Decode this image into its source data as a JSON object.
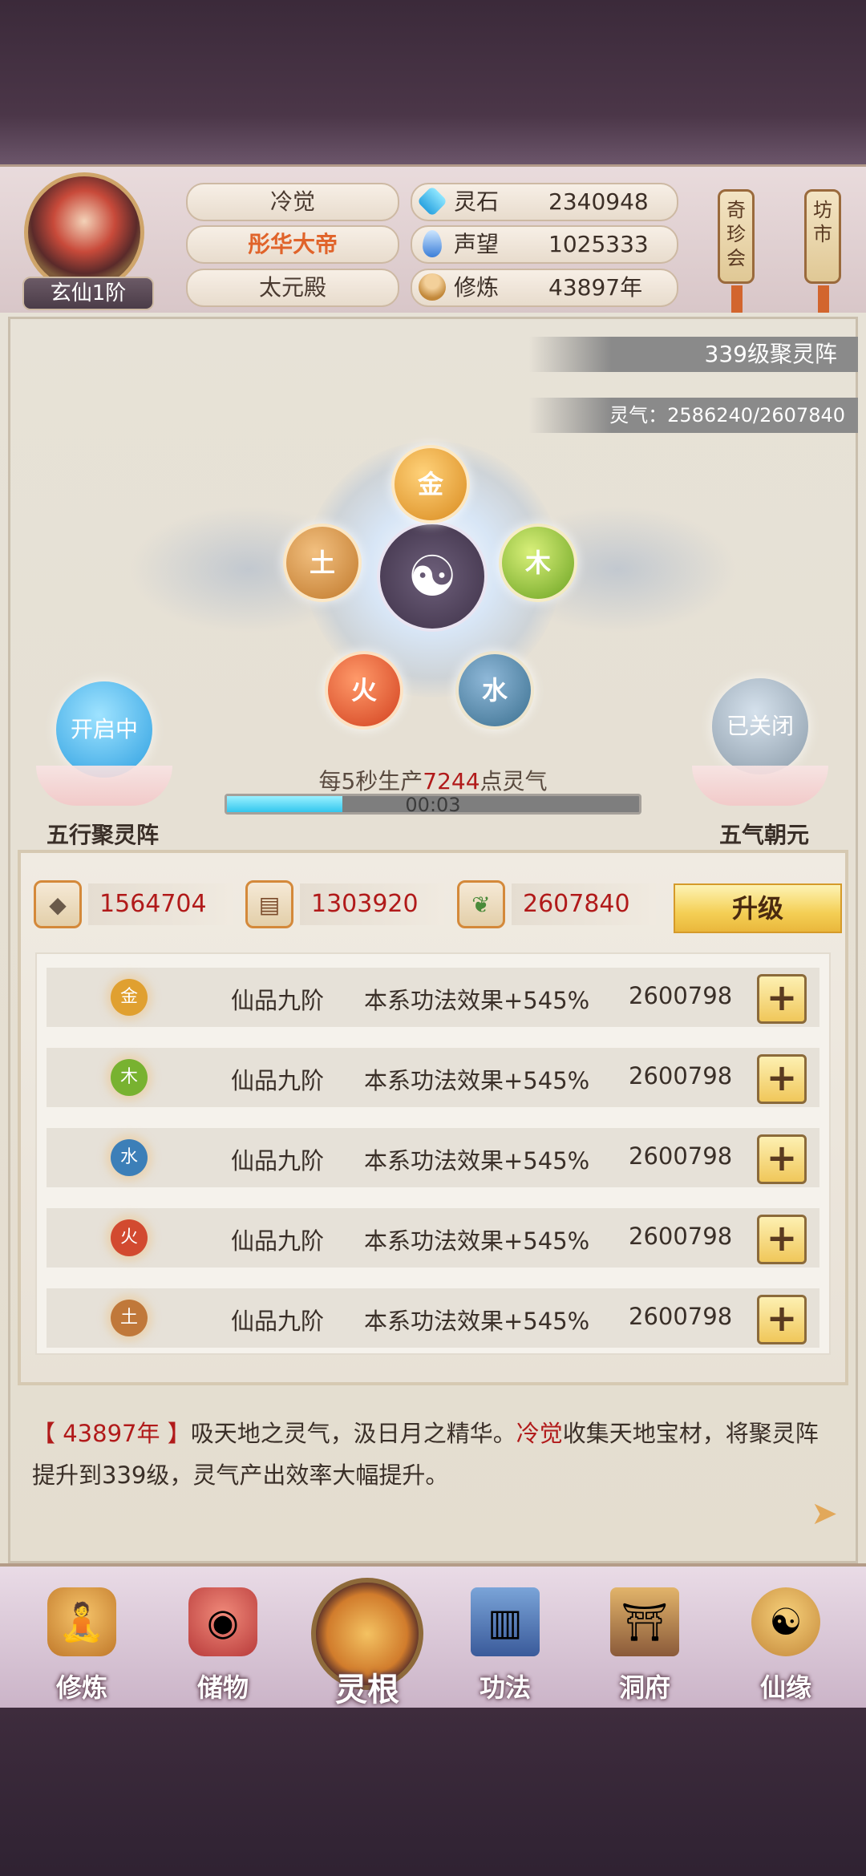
{
  "header": {
    "rank_label": "玄仙1阶",
    "player_name": "冷觉",
    "title": "彤华大帝",
    "sect": "太元殿",
    "resources": [
      {
        "label": "灵石",
        "value": "2340948",
        "icon": "spirit-stone-icon"
      },
      {
        "label": "声望",
        "value": "1025333",
        "icon": "prestige-icon"
      },
      {
        "label": "修炼",
        "value": "43897年",
        "icon": "cultivation-icon"
      }
    ],
    "scroll_left": "奇珍会",
    "scroll_right": "坊市"
  },
  "formation": {
    "level_banner": "339级聚灵阵",
    "qi_banner": "灵气：2586240/2607840",
    "elements": [
      "金",
      "木",
      "水",
      "火",
      "土"
    ],
    "left_orb_status": "开启中",
    "left_label": "五行聚灵阵",
    "right_orb_status": "已关闭",
    "right_label": "五气朝元",
    "production_prefix": "每5秒生产",
    "production_amount": "7244",
    "production_suffix": "点灵气",
    "timer": "00:03",
    "timer_progress": 0.28
  },
  "materials": [
    {
      "value": "1564704",
      "icon": "ore-icon"
    },
    {
      "value": "1303920",
      "icon": "wood-log-icon"
    },
    {
      "value": "2607840",
      "icon": "herb-icon"
    }
  ],
  "upgrade_label": "升级",
  "element_rows": [
    {
      "element": "金",
      "grade": "仙品九阶",
      "effect": "本系功法效果+545%",
      "cost": "2600798",
      "color": "#e0a030"
    },
    {
      "element": "木",
      "grade": "仙品九阶",
      "effect": "本系功法效果+545%",
      "cost": "2600798",
      "color": "#78b230"
    },
    {
      "element": "水",
      "grade": "仙品九阶",
      "effect": "本系功法效果+545%",
      "cost": "2600798",
      "color": "#3c7fb8"
    },
    {
      "element": "火",
      "grade": "仙品九阶",
      "effect": "本系功法效果+545%",
      "cost": "2600798",
      "color": "#d24a30"
    },
    {
      "element": "土",
      "grade": "仙品九阶",
      "effect": "本系功法效果+545%",
      "cost": "2600798",
      "color": "#c0783a"
    }
  ],
  "plus_label": "+",
  "log": {
    "year": "【 43897年 】",
    "text1": "吸天地之灵气，汲日月之精华。",
    "name": "冷觉",
    "text2": "收集天地宝材，将聚灵阵提升到339级，灵气产出效率大幅提升。"
  },
  "nav": [
    "修炼",
    "储物",
    "灵根",
    "功法",
    "洞府",
    "仙缘"
  ],
  "colors": {
    "accent_red": "#b11a1a",
    "title_orange": "#e0632a",
    "gold": "#f4cf55"
  }
}
